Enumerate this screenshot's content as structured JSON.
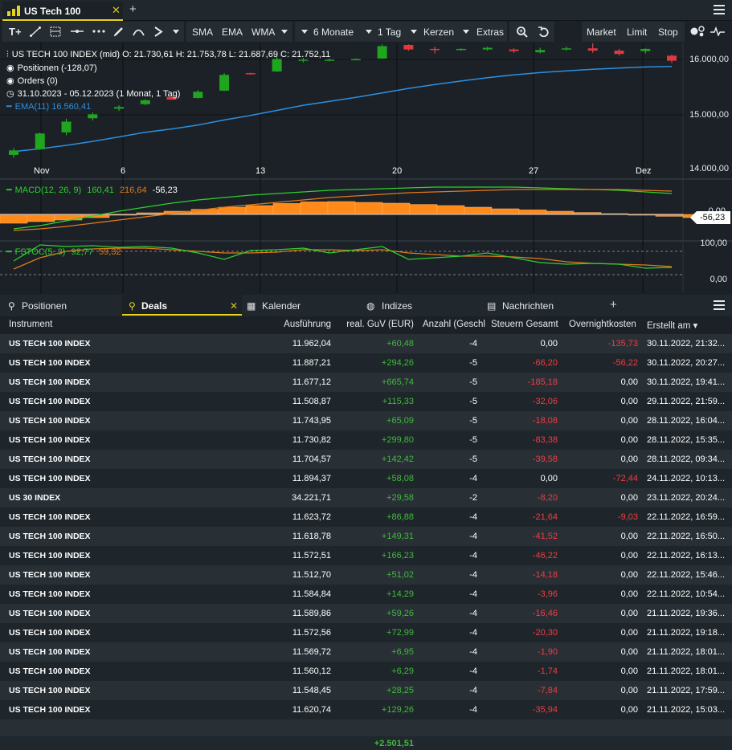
{
  "window": {
    "tab_title": "US Tech 100"
  },
  "toolbar": {
    "sma": "SMA",
    "ema": "EMA",
    "wma": "WMA",
    "period": "6 Monate",
    "interval": "1 Tag",
    "chart_type": "Kerzen",
    "extras": "Extras",
    "market": "Market",
    "limit": "Limit",
    "stop": "Stop"
  },
  "chart": {
    "instrument_line": "US TECH 100 INDEX (mid)  O: 21.730,61  H: 21.753,78  L: 21.687,69  C: 21.752,11",
    "positions": "Positionen (-128,07)",
    "orders": "Orders (0)",
    "range": "31.10.2023 - 05.12.2023   (1 Monat, 1 Tag)",
    "ema_label": "EMA(11)  16.560,41",
    "price_ticks": [
      "16.000,00",
      "15.000,00",
      "14.000,00"
    ],
    "x_ticks": [
      "Nov",
      "6",
      "13",
      "20",
      "27",
      "Dez"
    ],
    "macd_label": "MACD(12, 26, 9)",
    "macd_v1": "160,41",
    "macd_v2": "216,64",
    "macd_v3": "-56,23",
    "macd_tag": "-56,23",
    "macd_tick": "0,00",
    "fstoc_label": "FSTOC(5, 3)",
    "fstoc_v1": "92,77",
    "fstoc_v2": "59,32",
    "fstoc_ticks": [
      "100,00",
      "0,00"
    ],
    "colors": {
      "up": "#1fa51f",
      "down": "#e0383e",
      "ema": "#2d8fe0",
      "macd_hist": "#ff8a1a",
      "macd_line": "#2fcf2f",
      "signal": "#e07a1a"
    }
  },
  "chart_data": {
    "type": "candlestick",
    "x": [
      "31.10",
      "01.11",
      "02.11",
      "03.11",
      "06.11",
      "07.11",
      "08.11",
      "09.11",
      "10.11",
      "13.11",
      "14.11",
      "15.11",
      "16.11",
      "17.11",
      "20.11",
      "21.11",
      "22.11",
      "23.11",
      "24.11",
      "27.11",
      "28.11",
      "29.11",
      "30.11",
      "01.12",
      "04.11",
      "05.12"
    ],
    "candles": [
      [
        14300,
        14420,
        14250,
        14380
      ],
      [
        14400,
        14700,
        14390,
        14680
      ],
      [
        14700,
        14940,
        14650,
        14890
      ],
      [
        14950,
        15050,
        14910,
        15020
      ],
      [
        15120,
        15180,
        15080,
        15150
      ],
      [
        15200,
        15290,
        15180,
        15270
      ],
      [
        15330,
        15310,
        15280,
        15280
      ],
      [
        15310,
        15450,
        15300,
        15420
      ],
      [
        15440,
        15750,
        15430,
        15720
      ],
      [
        15750,
        15760,
        15720,
        15740
      ],
      [
        15780,
        16050,
        15770,
        16000
      ],
      [
        15980,
        16020,
        15940,
        15990
      ],
      [
        15990,
        16010,
        15960,
        15990
      ],
      [
        15990,
        16010,
        15980,
        16000
      ],
      [
        16010,
        16260,
        16000,
        16230
      ],
      [
        16250,
        16260,
        16150,
        16170
      ],
      [
        16180,
        16220,
        16100,
        16170
      ],
      [
        16170,
        16190,
        16150,
        16180
      ],
      [
        16170,
        16220,
        16150,
        16200
      ],
      [
        16170,
        16190,
        16110,
        16140
      ],
      [
        16120,
        16200,
        16100,
        16160
      ],
      [
        16180,
        16220,
        16150,
        16190
      ],
      [
        16190,
        16280,
        16110,
        16150
      ],
      [
        16150,
        16180,
        16060,
        16090
      ],
      [
        16140,
        16190,
        16100,
        16180
      ],
      [
        16060,
        16080,
        15930,
        15970
      ]
    ],
    "ema11": [
      14360,
      14410,
      14470,
      14540,
      14620,
      14700,
      14760,
      14830,
      14920,
      15000,
      15090,
      15180,
      15250,
      15320,
      15400,
      15480,
      15550,
      15610,
      15670,
      15720,
      15760,
      15790,
      15820,
      15840,
      15860,
      15870
    ],
    "ylim": [
      14000,
      16250
    ]
  },
  "grid": {
    "tabs": [
      {
        "label": "Positionen"
      },
      {
        "label": "Deals"
      },
      {
        "label": "Kalender"
      },
      {
        "label": "Indizes"
      },
      {
        "label": "Nachrichten"
      }
    ],
    "columns": [
      "Instrument",
      "Ausführung",
      "real. GuV (EUR)",
      "Anzahl (Geschl",
      "Steuern Gesamt",
      "Overnightkosten",
      "Erstellt am"
    ],
    "rows": [
      {
        "inst": "US TECH 100 INDEX",
        "exec": "11.962,04",
        "pnl": "+60,48",
        "qty": "-4",
        "tax": "0,00",
        "tax_neg": false,
        "on": "-135,73",
        "on_neg": true,
        "date": "30.11.2022, 21:32..."
      },
      {
        "inst": "US TECH 100 INDEX",
        "exec": "11.887,21",
        "pnl": "+294,26",
        "qty": "-5",
        "tax": "-66,20",
        "tax_neg": true,
        "on": "-56,22",
        "on_neg": true,
        "date": "30.11.2022, 20:27..."
      },
      {
        "inst": "US TECH 100 INDEX",
        "exec": "11.677,12",
        "pnl": "+665,74",
        "qty": "-5",
        "tax": "-185,18",
        "tax_neg": true,
        "on": "0,00",
        "on_neg": false,
        "date": "30.11.2022, 19:41..."
      },
      {
        "inst": "US TECH 100 INDEX",
        "exec": "11.508,87",
        "pnl": "+115,33",
        "qty": "-5",
        "tax": "-32,06",
        "tax_neg": true,
        "on": "0,00",
        "on_neg": false,
        "date": "29.11.2022, 21:59..."
      },
      {
        "inst": "US TECH 100 INDEX",
        "exec": "11.743,95",
        "pnl": "+65,09",
        "qty": "-5",
        "tax": "-18,08",
        "tax_neg": true,
        "on": "0,00",
        "on_neg": false,
        "date": "28.11.2022, 16:04..."
      },
      {
        "inst": "US TECH 100 INDEX",
        "exec": "11.730,82",
        "pnl": "+299,80",
        "qty": "-5",
        "tax": "-83,38",
        "tax_neg": true,
        "on": "0,00",
        "on_neg": false,
        "date": "28.11.2022, 15:35..."
      },
      {
        "inst": "US TECH 100 INDEX",
        "exec": "11.704,57",
        "pnl": "+142,42",
        "qty": "-5",
        "tax": "-39,58",
        "tax_neg": true,
        "on": "0,00",
        "on_neg": false,
        "date": "28.11.2022, 09:34..."
      },
      {
        "inst": "US TECH 100 INDEX",
        "exec": "11.894,37",
        "pnl": "+58,08",
        "qty": "-4",
        "tax": "0,00",
        "tax_neg": false,
        "on": "-72,44",
        "on_neg": true,
        "date": "24.11.2022, 10:13..."
      },
      {
        "inst": "US 30 INDEX",
        "exec": "34.221,71",
        "pnl": "+29,58",
        "qty": "-2",
        "tax": "-8,20",
        "tax_neg": true,
        "on": "0,00",
        "on_neg": false,
        "date": "23.11.2022, 20:24..."
      },
      {
        "inst": "US TECH 100 INDEX",
        "exec": "11.623,72",
        "pnl": "+86,88",
        "qty": "-4",
        "tax": "-21,64",
        "tax_neg": true,
        "on": "-9,03",
        "on_neg": true,
        "date": "22.11.2022, 16:59..."
      },
      {
        "inst": "US TECH 100 INDEX",
        "exec": "11.618,78",
        "pnl": "+149,31",
        "qty": "-4",
        "tax": "-41,52",
        "tax_neg": true,
        "on": "0,00",
        "on_neg": false,
        "date": "22.11.2022, 16:50..."
      },
      {
        "inst": "US TECH 100 INDEX",
        "exec": "11.572,51",
        "pnl": "+166,23",
        "qty": "-4",
        "tax": "-46,22",
        "tax_neg": true,
        "on": "0,00",
        "on_neg": false,
        "date": "22.11.2022, 16:13..."
      },
      {
        "inst": "US TECH 100 INDEX",
        "exec": "11.512,70",
        "pnl": "+51,02",
        "qty": "-4",
        "tax": "-14,18",
        "tax_neg": true,
        "on": "0,00",
        "on_neg": false,
        "date": "22.11.2022, 15:46..."
      },
      {
        "inst": "US TECH 100 INDEX",
        "exec": "11.584,84",
        "pnl": "+14,29",
        "qty": "-4",
        "tax": "-3,96",
        "tax_neg": true,
        "on": "0,00",
        "on_neg": false,
        "date": "22.11.2022, 10:54..."
      },
      {
        "inst": "US TECH 100 INDEX",
        "exec": "11.589,86",
        "pnl": "+59,26",
        "qty": "-4",
        "tax": "-16,46",
        "tax_neg": true,
        "on": "0,00",
        "on_neg": false,
        "date": "21.11.2022, 19:36..."
      },
      {
        "inst": "US TECH 100 INDEX",
        "exec": "11.572,56",
        "pnl": "+72,99",
        "qty": "-4",
        "tax": "-20,30",
        "tax_neg": true,
        "on": "0,00",
        "on_neg": false,
        "date": "21.11.2022, 19:18..."
      },
      {
        "inst": "US TECH 100 INDEX",
        "exec": "11.569,72",
        "pnl": "+6,95",
        "qty": "-4",
        "tax": "-1,90",
        "tax_neg": true,
        "on": "0,00",
        "on_neg": false,
        "date": "21.11.2022, 18:01..."
      },
      {
        "inst": "US TECH 100 INDEX",
        "exec": "11.560,12",
        "pnl": "+6,29",
        "qty": "-4",
        "tax": "-1,74",
        "tax_neg": true,
        "on": "0,00",
        "on_neg": false,
        "date": "21.11.2022, 18:01..."
      },
      {
        "inst": "US TECH 100 INDEX",
        "exec": "11.548,45",
        "pnl": "+28,25",
        "qty": "-4",
        "tax": "-7,84",
        "tax_neg": true,
        "on": "0,00",
        "on_neg": false,
        "date": "21.11.2022, 17:59..."
      },
      {
        "inst": "US TECH 100 INDEX",
        "exec": "11.620,74",
        "pnl": "+129,26",
        "qty": "-4",
        "tax": "-35,94",
        "tax_neg": true,
        "on": "0,00",
        "on_neg": false,
        "date": "21.11.2022, 15:03..."
      }
    ],
    "total": "+2.501,51"
  }
}
